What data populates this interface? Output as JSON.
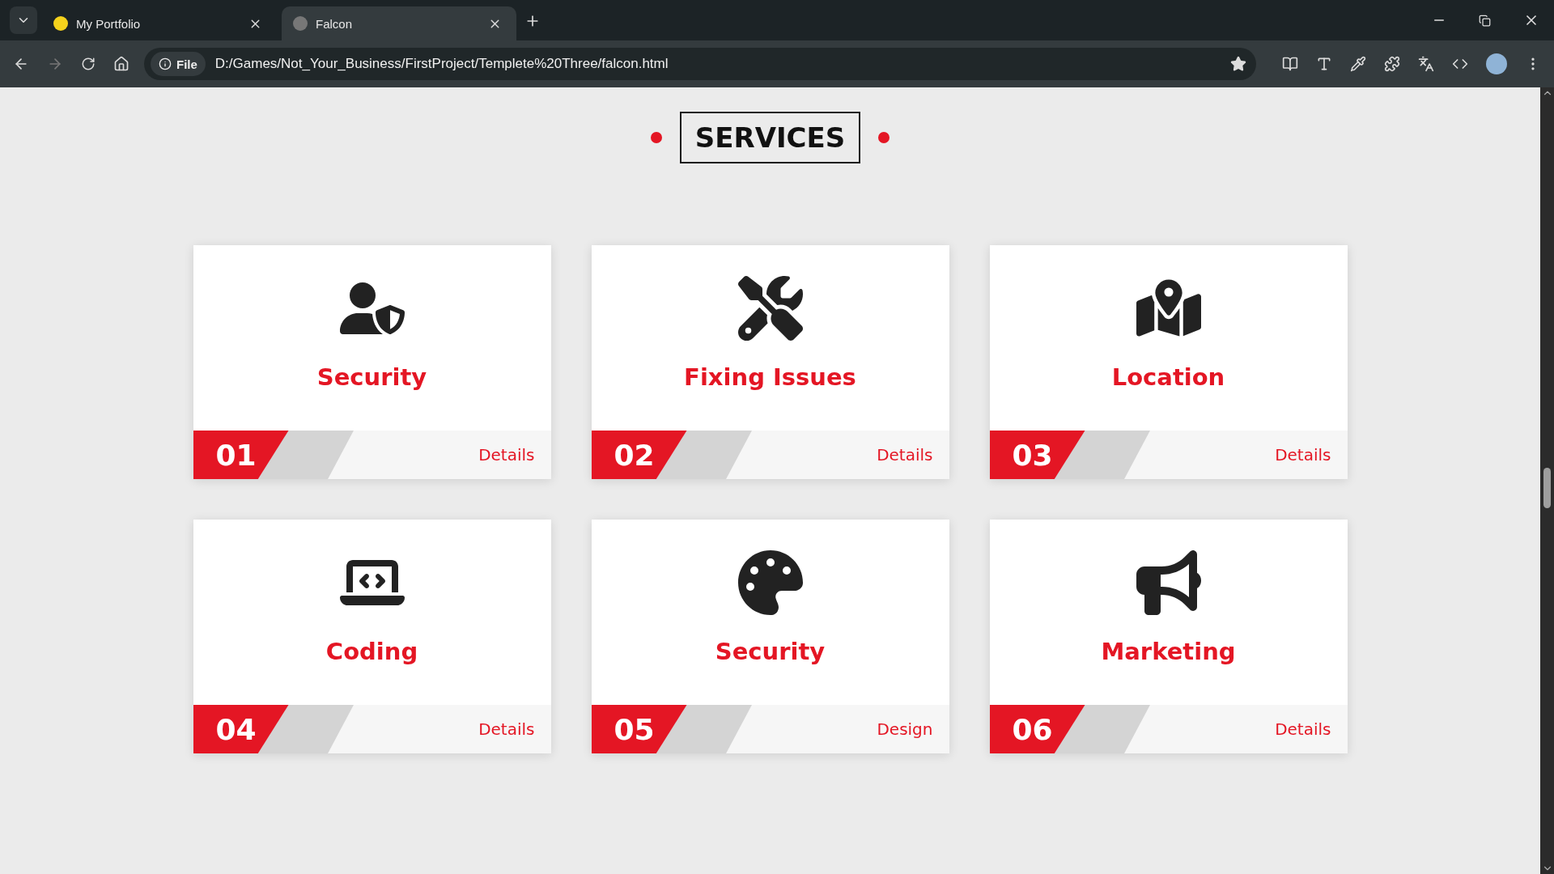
{
  "browser": {
    "tabs": [
      {
        "title": "My Portfolio",
        "selected": false
      },
      {
        "title": "Falcon",
        "selected": true
      }
    ],
    "address": {
      "badge": "File",
      "url": "D:/Games/Not_Your_Business/FirstProject/Templete%20Three/falcon.html"
    }
  },
  "section": {
    "title": "SERVICES"
  },
  "services": [
    {
      "name": "Security",
      "number": "01",
      "link": "Details"
    },
    {
      "name": "Fixing Issues",
      "number": "02",
      "link": "Details"
    },
    {
      "name": "Location",
      "number": "03",
      "link": "Details"
    },
    {
      "name": "Coding",
      "number": "04",
      "link": "Details"
    },
    {
      "name": "Security",
      "number": "05",
      "link": "Design"
    },
    {
      "name": "Marketing",
      "number": "06",
      "link": "Details"
    }
  ]
}
